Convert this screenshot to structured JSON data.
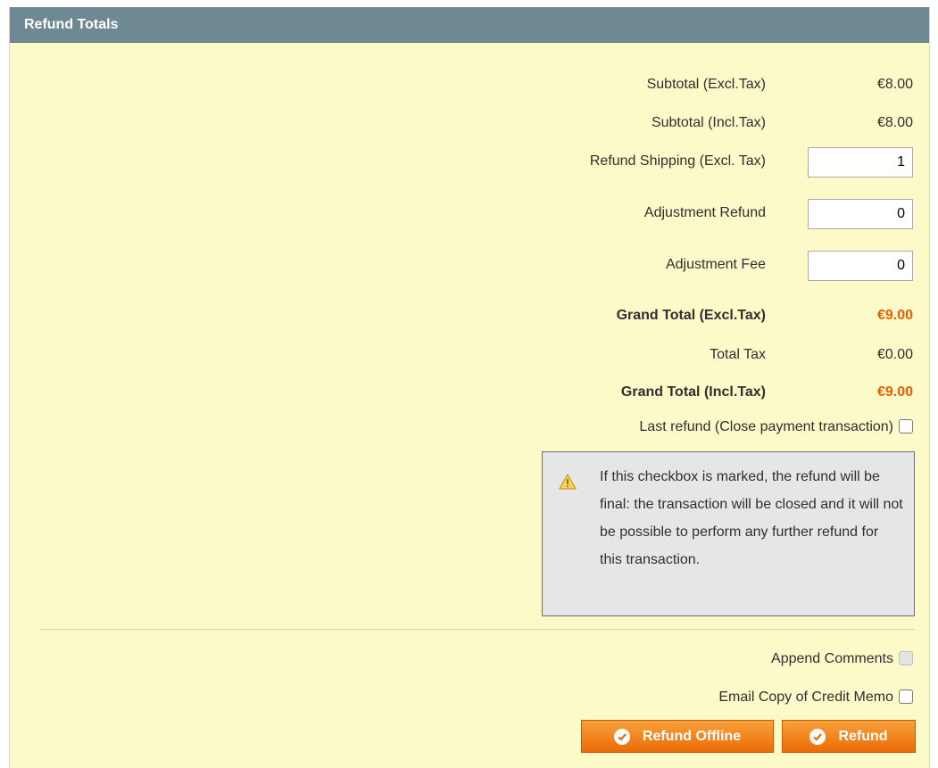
{
  "panel": {
    "title": "Refund Totals"
  },
  "totals": {
    "subtotal_excl_label": "Subtotal (Excl.Tax)",
    "subtotal_excl_value": "€8.00",
    "subtotal_incl_label": "Subtotal (Incl.Tax)",
    "subtotal_incl_value": "€8.00",
    "refund_shipping_label": "Refund Shipping (Excl. Tax)",
    "refund_shipping_value": "1",
    "adjustment_refund_label": "Adjustment Refund",
    "adjustment_refund_value": "0",
    "adjustment_fee_label": "Adjustment Fee",
    "adjustment_fee_value": "0",
    "grand_total_excl_label": "Grand Total (Excl.Tax)",
    "grand_total_excl_value": "€9.00",
    "total_tax_label": "Total Tax",
    "total_tax_value": "€0.00",
    "grand_total_incl_label": "Grand Total (Incl.Tax)",
    "grand_total_incl_value": "€9.00"
  },
  "last_refund": {
    "label": "Last refund (Close payment transaction)",
    "checked": false
  },
  "notice": {
    "icon": "warning-icon",
    "text": "If this checkbox is marked, the refund will be final: the transaction will be closed and it will not be possible to perform any further refund for this transaction."
  },
  "options": {
    "append_comments_label": "Append Comments",
    "append_comments_disabled": true,
    "email_copy_label": "Email Copy of Credit Memo",
    "email_copy_checked": false
  },
  "buttons": {
    "refund_offline_label": "Refund Offline",
    "refund_label": "Refund",
    "icon": "check-circle-icon"
  },
  "colors": {
    "header_bg": "#6e8993",
    "panel_bg": "#fdfac9",
    "accent_orange": "#eb5e00",
    "button_orange": "#f18200"
  }
}
